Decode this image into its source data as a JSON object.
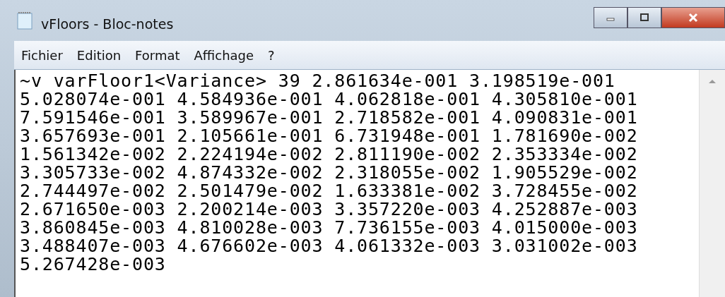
{
  "window": {
    "title": "vFloors - Bloc-notes"
  },
  "menu": [
    "Fichier",
    "Edition",
    "Format",
    "Affichage",
    "?"
  ],
  "lines": [
    "~v varFloor1<Variance> 39 2.861634e-001 3.198519e-001",
    "5.028074e-001 4.584936e-001 4.062818e-001 4.305810e-001",
    "7.591546e-001 3.589967e-001 2.718582e-001 4.090831e-001",
    "3.657693e-001 2.105661e-001 6.731948e-001 1.781690e-002",
    "1.561342e-002 2.224194e-002 2.811190e-002 2.353334e-002",
    "3.305733e-002 4.874332e-002 2.318055e-002 1.905529e-002",
    "2.744497e-002 2.501479e-002 1.633381e-002 3.728455e-002",
    "2.671650e-003 2.200214e-003 3.357220e-003 4.252887e-003",
    "3.860845e-003 4.810028e-003 7.736155e-003 4.015000e-003",
    "3.488407e-003 4.676602e-003 4.061332e-003 3.031002e-003",
    "5.267428e-003"
  ]
}
